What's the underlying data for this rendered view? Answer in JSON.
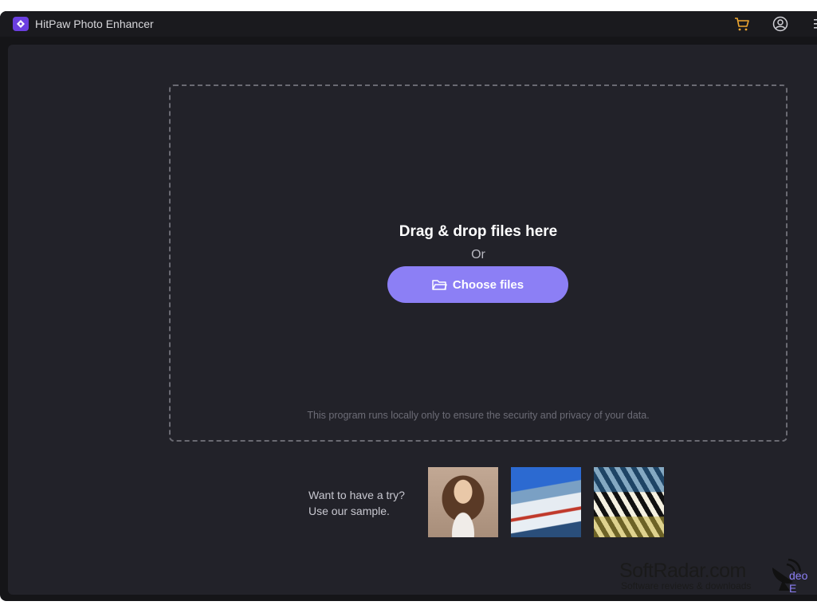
{
  "app": {
    "title": "HitPaw Photo Enhancer",
    "accent_color": "#8c7ff5",
    "icons": [
      "app-logo-icon",
      "cart-icon",
      "account-icon",
      "menu-icon",
      "folder-icon"
    ]
  },
  "dropzone": {
    "title": "Drag & drop files here",
    "or_label": "Or",
    "choose_button": "Choose files",
    "privacy_note": "This program runs locally only to ensure the security and privacy of your data."
  },
  "samples": {
    "line1": "Want to have a try?",
    "line2": "Use our sample.",
    "items": [
      "portrait",
      "winter-village",
      "fish"
    ]
  },
  "footer": {
    "link_partial": "deo E"
  },
  "watermark": {
    "brand": "SoftRadar.com",
    "tagline": "Software reviews & downloads"
  }
}
